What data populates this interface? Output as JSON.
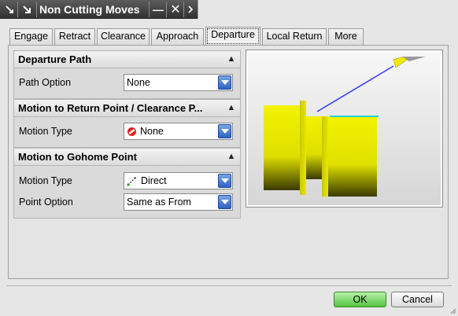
{
  "window": {
    "title": "Non Cutting Moves",
    "close_label": "✕",
    "minimize_label": "—"
  },
  "tabs": [
    {
      "label": "Engage"
    },
    {
      "label": "Retract"
    },
    {
      "label": "Clearance"
    },
    {
      "label": "Approach"
    },
    {
      "label": "Departure",
      "active": true
    },
    {
      "label": "Local Return"
    },
    {
      "label": "More"
    }
  ],
  "departure_path": {
    "title": "Departure Path",
    "path_option_label": "Path Option",
    "path_option_value": "None"
  },
  "return_point": {
    "title": "Motion to Return Point / Clearance P...",
    "motion_type_label": "Motion Type",
    "motion_type_value": "None",
    "motion_type_icon": "no-entry-icon"
  },
  "gohome": {
    "title": "Motion to Gohome Point",
    "motion_type_label": "Motion Type",
    "motion_type_value": "Direct",
    "motion_type_icon": "direct-move-icon",
    "point_option_label": "Point Option",
    "point_option_value": "Same as From"
  },
  "buttons": {
    "ok": "OK",
    "cancel": "Cancel"
  },
  "colors": {
    "part": "#e8e800",
    "tool": "#f2e800",
    "move_line": "#3c3cff",
    "ok_button": "#55c442"
  }
}
